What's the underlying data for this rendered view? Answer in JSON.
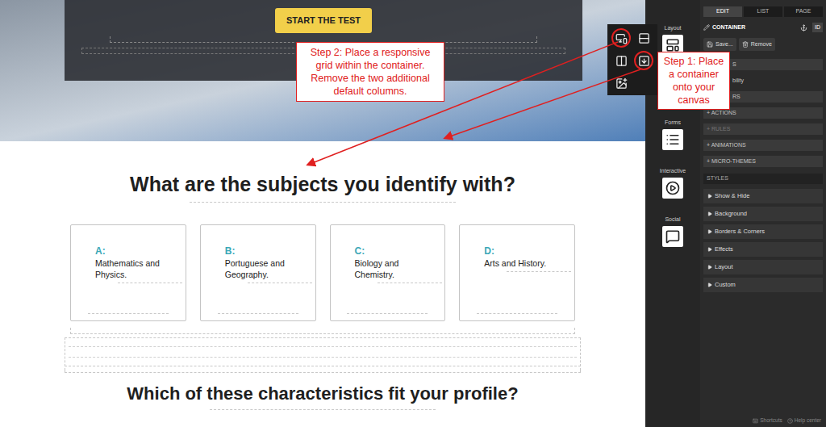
{
  "hero": {
    "button": "START THE TEST"
  },
  "questions": [
    {
      "heading": "What are the subjects you identify with?",
      "options": [
        {
          "letter": "A:",
          "text": "Mathematics and Physics."
        },
        {
          "letter": "B:",
          "text": "Portuguese and Geography."
        },
        {
          "letter": "C:",
          "text": "Biology and Chemistry."
        },
        {
          "letter": "D:",
          "text": "Arts and History."
        }
      ]
    },
    {
      "heading": "Which of these characteristics fit your profile?",
      "options": []
    }
  ],
  "annotations": {
    "step2": "Step 2: Place a responsive grid within the container. Remove the two additional default columns.",
    "step1": "Step 1: Place a container onto your canvas"
  },
  "flyout": {
    "items": [
      {
        "circled": true
      },
      {
        "circled": false
      },
      {
        "circled": false
      },
      {
        "circled": true
      },
      {
        "circled": false
      }
    ]
  },
  "palette": {
    "groups": [
      "Layout",
      "Forms",
      "Interactive",
      "Social"
    ]
  },
  "editor": {
    "tabs": [
      {
        "label": "EDIT",
        "selected": true
      },
      {
        "label": "LIST",
        "selected": false
      },
      {
        "label": "PAGE",
        "selected": false
      }
    ],
    "element": "CONTAINER",
    "id_button": "ID",
    "buttons": [
      "Save...",
      "Remove"
    ],
    "sections": [
      {
        "label": "S",
        "kind": "bar-cut",
        "disabled": false
      },
      {
        "label": "bility",
        "kind": "line-cut",
        "disabled": false
      },
      {
        "label": "RS",
        "kind": "bar-cut",
        "disabled": false
      },
      {
        "label": "+ ACTIONS",
        "kind": "bar",
        "disabled": false
      },
      {
        "label": "+ RULES",
        "kind": "bar",
        "disabled": true
      },
      {
        "label": "+ ANIMATIONS",
        "kind": "bar",
        "disabled": false
      },
      {
        "label": "+ MICRO-THEMES",
        "kind": "bar",
        "disabled": false
      }
    ],
    "styles_label": "STYLES",
    "styles": [
      "Show & Hide",
      "Background",
      "Borders & Corners",
      "Effects",
      "Layout",
      "Custom"
    ]
  },
  "footer": [
    "Shortcuts",
    "Help center"
  ]
}
